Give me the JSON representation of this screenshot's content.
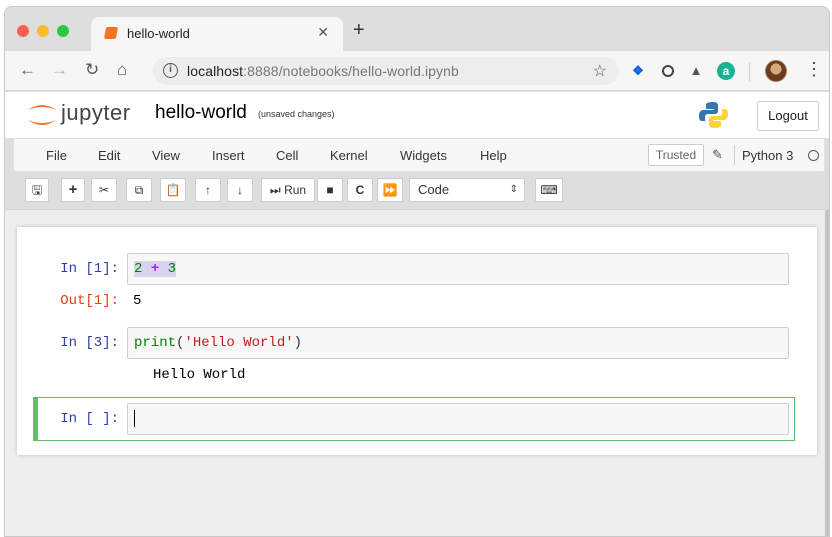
{
  "browser": {
    "tab_title": "hello-world",
    "new_tab": "+",
    "url_host": "localhost",
    "url_rest": ":8888/notebooks/hello-world.ipynb",
    "avatar": "user-avatar"
  },
  "jupyter": {
    "logo_text": "jupyter",
    "notebook_name": "hello-world",
    "save_status": "(unsaved changes)",
    "logout_label": "Logout",
    "menu": [
      "File",
      "Edit",
      "View",
      "Insert",
      "Cell",
      "Kernel",
      "Widgets",
      "Help"
    ],
    "trusted_label": "Trusted",
    "kernel_name": "Python 3",
    "toolbar": {
      "run_label": "Run",
      "cell_type": "Code"
    }
  },
  "cells": [
    {
      "in_prompt": "In [1]:",
      "code": {
        "left": "2",
        "op": "+",
        "right": "3"
      },
      "out_prompt": "Out[1]:",
      "output": "5"
    },
    {
      "in_prompt": "In [3]:",
      "code": {
        "fn": "print",
        "open": "(",
        "str": "'Hello World'",
        "close": ")"
      },
      "output": "Hello World"
    },
    {
      "in_prompt": "In [ ]:",
      "code": ""
    }
  ],
  "colors": {
    "prompt_in": "#303f9f",
    "prompt_out": "#d84315",
    "active_cell_border": "#66bb6a",
    "jupyter_orange": "#f37524"
  }
}
